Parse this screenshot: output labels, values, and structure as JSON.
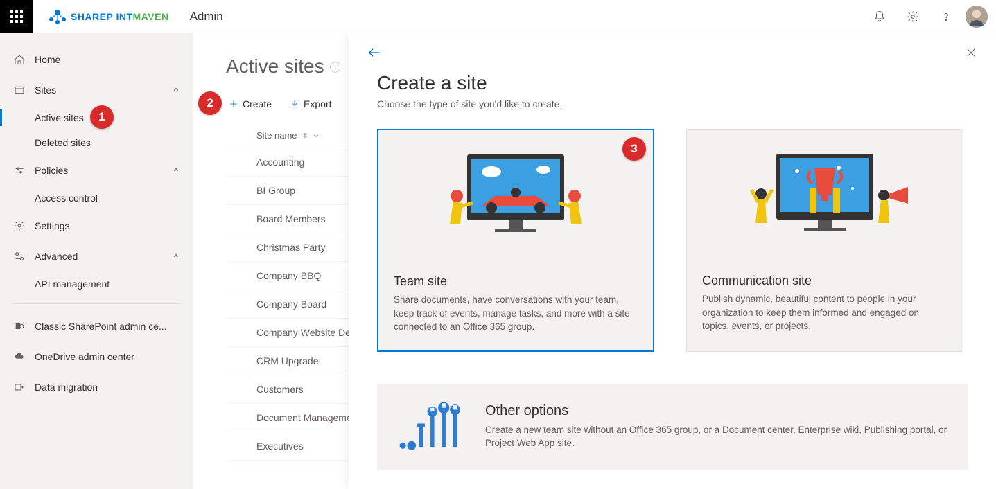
{
  "header": {
    "brand_share": "SHARE",
    "brand_point": "P    INT",
    "brand_maven": "MAVEN",
    "app_title": "Admin"
  },
  "sidebar": {
    "home": "Home",
    "sites": "Sites",
    "active_sites": "Active sites",
    "deleted_sites": "Deleted sites",
    "policies": "Policies",
    "access_control": "Access control",
    "settings": "Settings",
    "advanced": "Advanced",
    "api_management": "API management",
    "classic_admin": "Classic SharePoint admin ce...",
    "onedrive_admin": "OneDrive admin center",
    "data_migration": "Data migration"
  },
  "page": {
    "title": "Active sites",
    "cmd_create": "Create",
    "cmd_export": "Export",
    "col_site_name": "Site name",
    "sites": [
      "Accounting",
      "BI Group",
      "Board Members",
      "Christmas Party",
      "Company BBQ",
      "Company Board",
      "Company Website Dev",
      "CRM Upgrade",
      "Customers",
      "Document Management",
      "Executives"
    ]
  },
  "panel": {
    "title": "Create a site",
    "subtitle": "Choose the type of site you'd like to create.",
    "team_title": "Team site",
    "team_desc": "Share documents, have conversations with your team, keep track of events, manage tasks, and more with a site connected to an Office 365 group.",
    "comm_title": "Communication site",
    "comm_desc": "Publish dynamic, beautiful content to people in your organization to keep them informed and engaged on topics, events, or projects.",
    "other_title": "Other options",
    "other_desc": "Create a new team site without an Office 365 group, or a Document center, Enterprise wiki, Publishing portal, or Project Web App site."
  },
  "badges": {
    "b1": "1",
    "b2": "2",
    "b3": "3"
  }
}
